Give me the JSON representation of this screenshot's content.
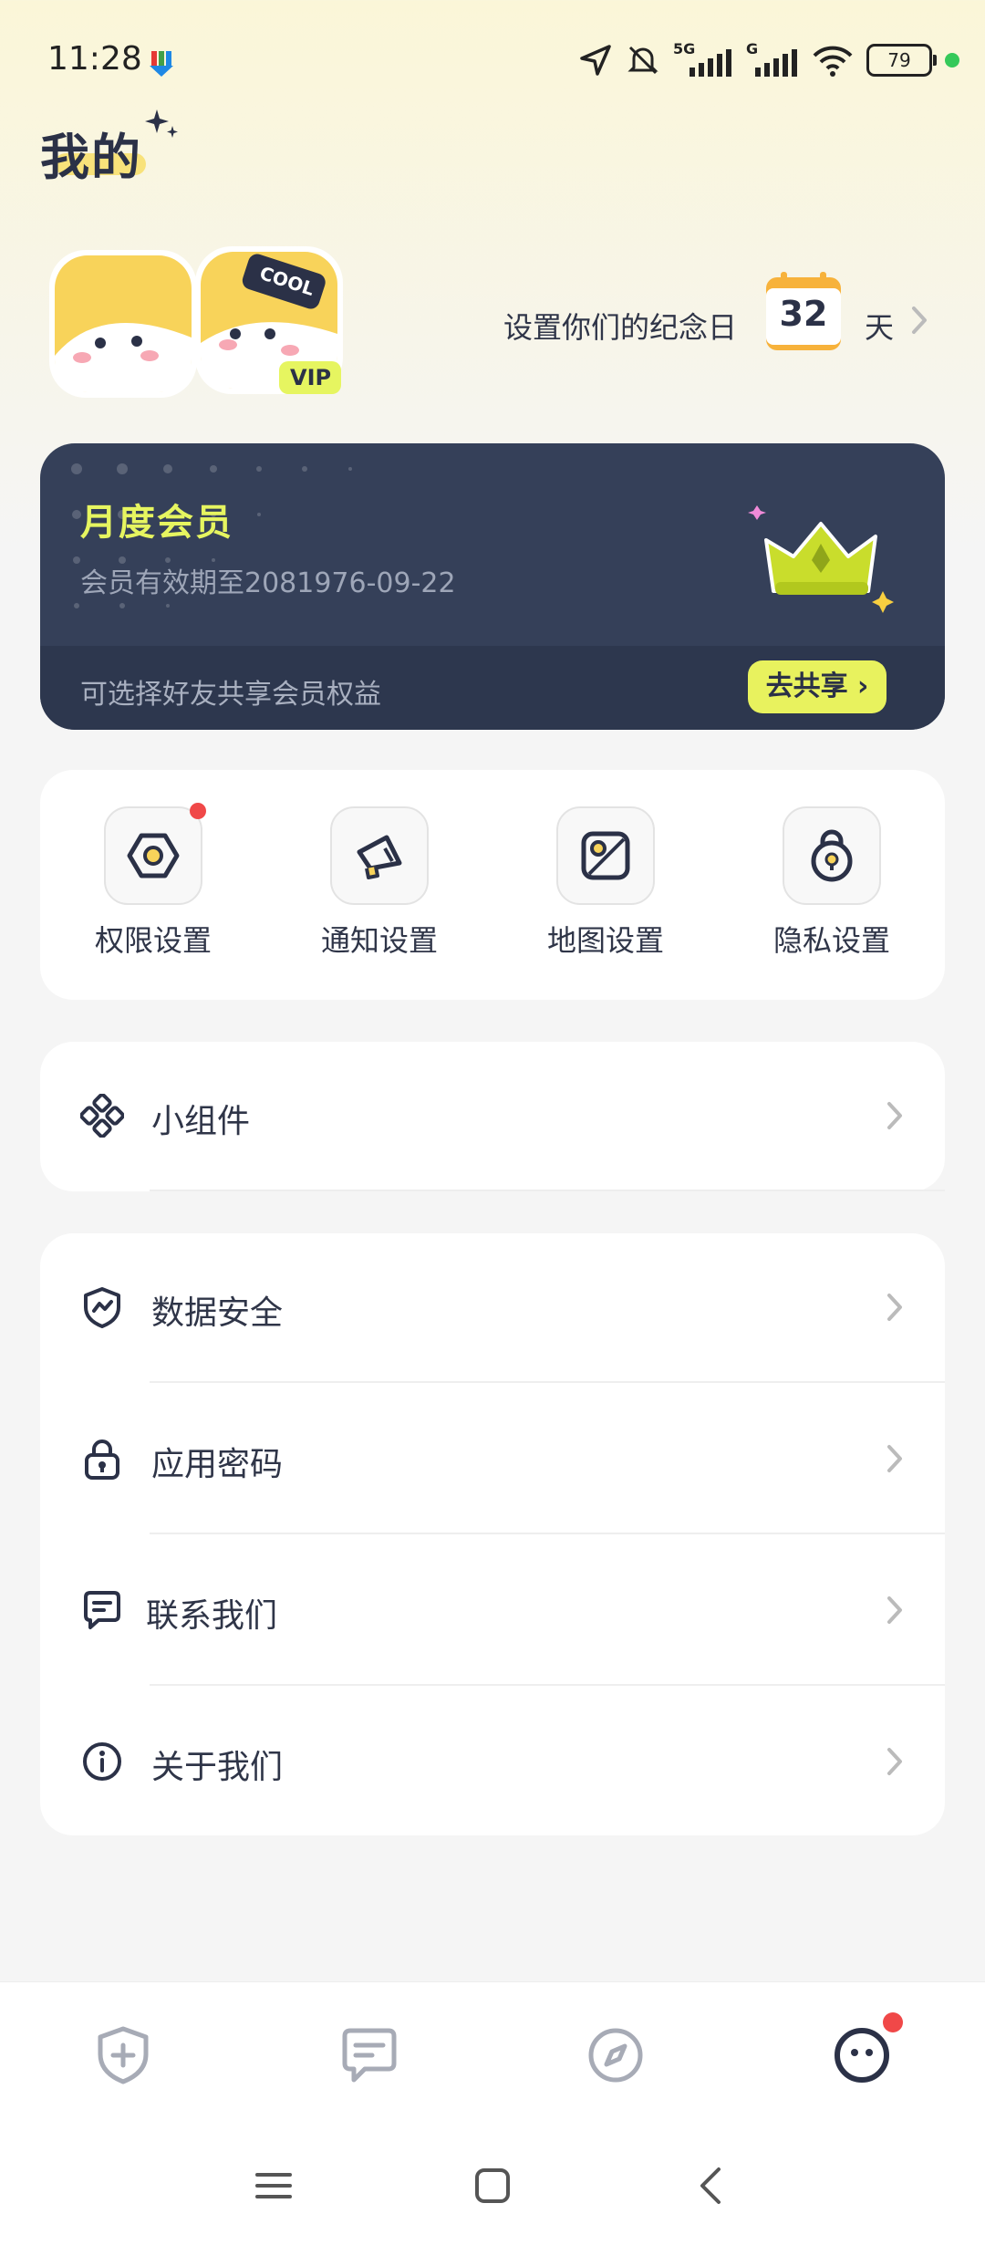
{
  "status_bar": {
    "time": "11:28",
    "network_5g": "5G",
    "network_g": "G",
    "battery": "79"
  },
  "header": {
    "title": "我的"
  },
  "couple": {
    "avatar_badge": "COOL",
    "vip_badge": "VIP",
    "anniversary_label": "设置你们的纪念日",
    "days_count": "32",
    "days_unit": "天"
  },
  "membership": {
    "title": "月度会员",
    "expiry": "会员有效期至2081976-09-22",
    "share_hint": "可选择好友共享会员权益",
    "share_button": "去共享"
  },
  "quick_settings": [
    {
      "label": "权限设置",
      "icon": "hexagon-settings-icon",
      "has_dot": true
    },
    {
      "label": "通知设置",
      "icon": "megaphone-icon",
      "has_dot": false
    },
    {
      "label": "地图设置",
      "icon": "map-icon",
      "has_dot": false
    },
    {
      "label": "隐私设置",
      "icon": "lock-icon",
      "has_dot": false
    }
  ],
  "widgets_section": {
    "label": "小组件",
    "icon": "widgets-icon"
  },
  "menu": [
    {
      "label": "数据安全",
      "icon": "shield-icon"
    },
    {
      "label": "应用密码",
      "icon": "padlock-icon"
    },
    {
      "label": "联系我们",
      "icon": "chat-icon"
    },
    {
      "label": "关于我们",
      "icon": "info-icon"
    }
  ],
  "bottom_nav": [
    {
      "name": "home",
      "icon": "shield-plus-icon"
    },
    {
      "name": "messages",
      "icon": "message-icon"
    },
    {
      "name": "discover",
      "icon": "compass-icon"
    },
    {
      "name": "profile",
      "icon": "face-icon",
      "active": true,
      "has_dot": true
    }
  ],
  "colors": {
    "accent": "#e8f25e",
    "card_dark": "#354059",
    "text": "#2f3548",
    "dot": "#f04848"
  }
}
